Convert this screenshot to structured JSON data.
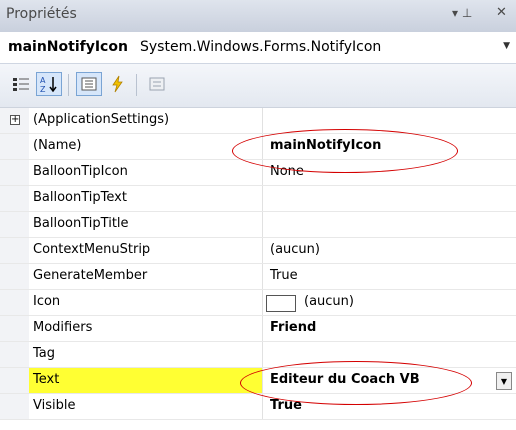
{
  "window": {
    "title": "Propriétés",
    "pin_glyph": "▾ ⊥",
    "close_glyph": "✕"
  },
  "selector": {
    "object_name": "mainNotifyIcon",
    "object_type": "System.Windows.Forms.NotifyIcon"
  },
  "toolbar": {
    "icons": [
      "categorized-icon",
      "alphabetical-icon",
      "properties-icon",
      "events-icon",
      "property-pages-icon"
    ]
  },
  "properties": [
    {
      "name": "(ApplicationSettings)",
      "value": "",
      "expandable": true
    },
    {
      "name": "(Name)",
      "value": "mainNotifyIcon",
      "bold": true
    },
    {
      "name": "BalloonTipIcon",
      "value": "None"
    },
    {
      "name": "BalloonTipText",
      "value": ""
    },
    {
      "name": "BalloonTipTitle",
      "value": ""
    },
    {
      "name": "ContextMenuStrip",
      "value": "(aucun)"
    },
    {
      "name": "GenerateMember",
      "value": "True"
    },
    {
      "name": "Icon",
      "value": "(aucun)"
    },
    {
      "name": "Modifiers",
      "value": "Friend",
      "bold": true
    },
    {
      "name": "Tag",
      "value": ""
    },
    {
      "name": "Text",
      "value": "Editeur du Coach VB",
      "bold": true,
      "selected": true
    },
    {
      "name": "Visible",
      "value": "True",
      "bold": true
    }
  ],
  "colors": {
    "selected_row": "#ffff33",
    "annotation": "#d40000"
  }
}
